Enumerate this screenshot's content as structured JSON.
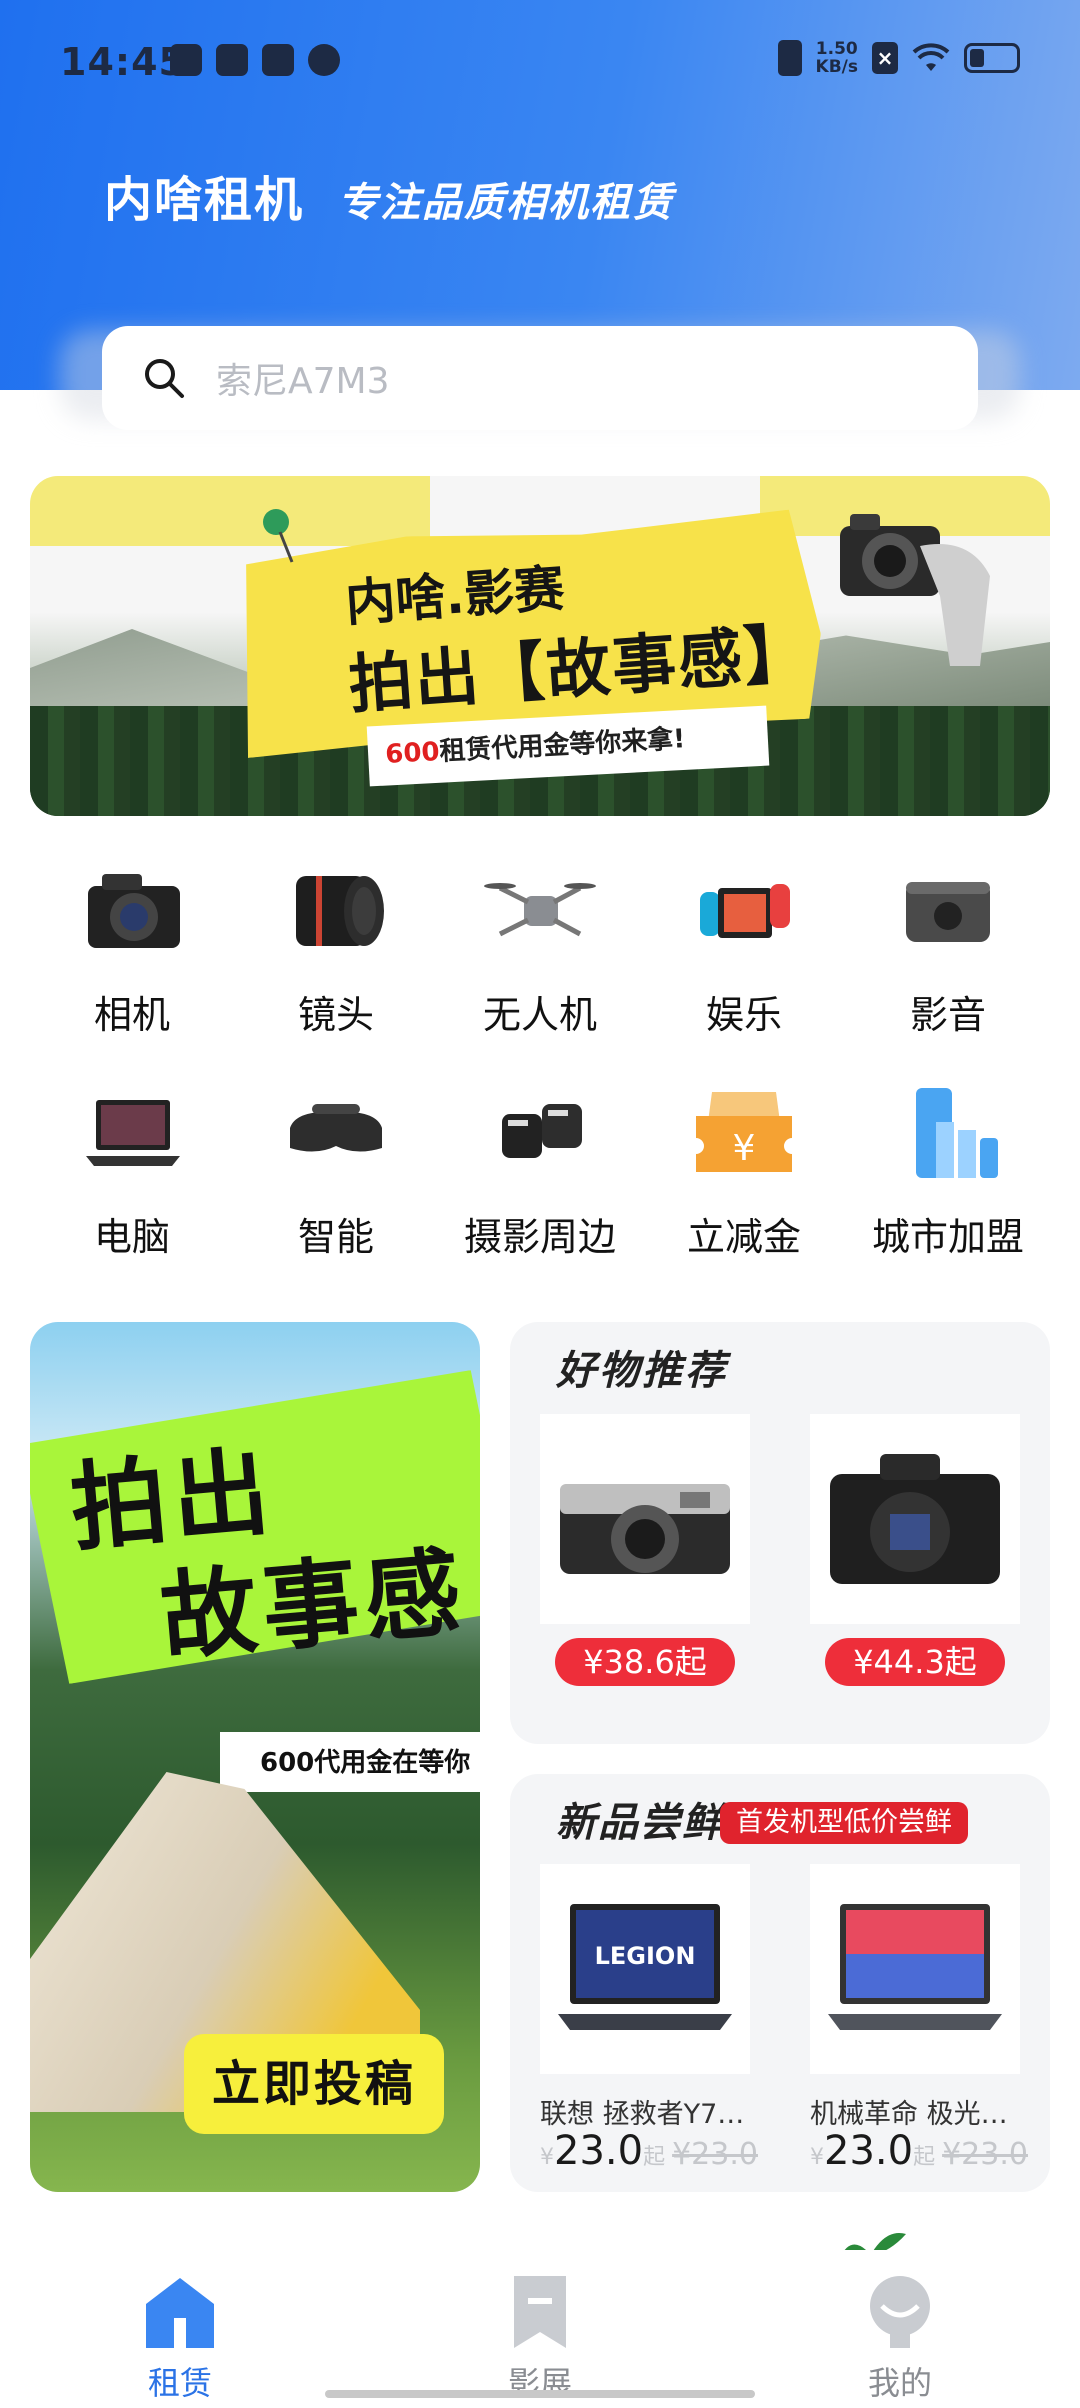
{
  "status_bar": {
    "time": "14:45",
    "net_speed_value": "1.50",
    "net_speed_unit": "KB/s",
    "x_badge": "×"
  },
  "header": {
    "app_title": "内啥租机",
    "slogan": "专注品质相机租赁"
  },
  "search": {
    "placeholder": "索尼A7M3"
  },
  "banner": {
    "title_line1": "内啥.影赛",
    "title_line2": "拍出【故事感】",
    "subtitle_amount": "600",
    "subtitle_rest": "租赁代用金等你来拿!"
  },
  "categories": [
    {
      "label": "相机",
      "icon": "camera-icon"
    },
    {
      "label": "镜头",
      "icon": "lens-icon"
    },
    {
      "label": "无人机",
      "icon": "drone-icon"
    },
    {
      "label": "娱乐",
      "icon": "game-console-icon"
    },
    {
      "label": "影音",
      "icon": "projector-icon"
    },
    {
      "label": "电脑",
      "icon": "laptop-icon"
    },
    {
      "label": "智能",
      "icon": "vr-headset-icon"
    },
    {
      "label": "摄影周边",
      "icon": "microphone-icon"
    },
    {
      "label": "立减金",
      "icon": "coupon-icon"
    },
    {
      "label": "城市加盟",
      "icon": "city-chart-icon"
    }
  ],
  "promo": {
    "line1": "拍出",
    "line2": "故事感",
    "strip": "600代用金在等你",
    "button": "立即投稿"
  },
  "recommend": {
    "title": "好物推荐",
    "items": [
      {
        "price": "¥38.6起"
      },
      {
        "price": "¥44.3起"
      }
    ]
  },
  "new_products": {
    "title": "新品尝鲜",
    "badge": "首发机型低价尝鲜",
    "items": [
      {
        "name": "联想 拯救者Y7…",
        "currency": "¥",
        "price": "23.0",
        "suffix": "起",
        "original": "¥23.0"
      },
      {
        "name": "机械革命 极光…",
        "currency": "¥",
        "price": "23.0",
        "suffix": "起",
        "original": "¥23.0"
      }
    ]
  },
  "bottom_nav": {
    "items": [
      {
        "label": "租赁",
        "active": true
      },
      {
        "label": "影展",
        "active": false
      },
      {
        "label": "我的",
        "active": false
      }
    ]
  },
  "colors": {
    "header_blue": "#1f70ef",
    "accent_blue": "#2b73e6",
    "price_red": "#ee2e3a"
  }
}
